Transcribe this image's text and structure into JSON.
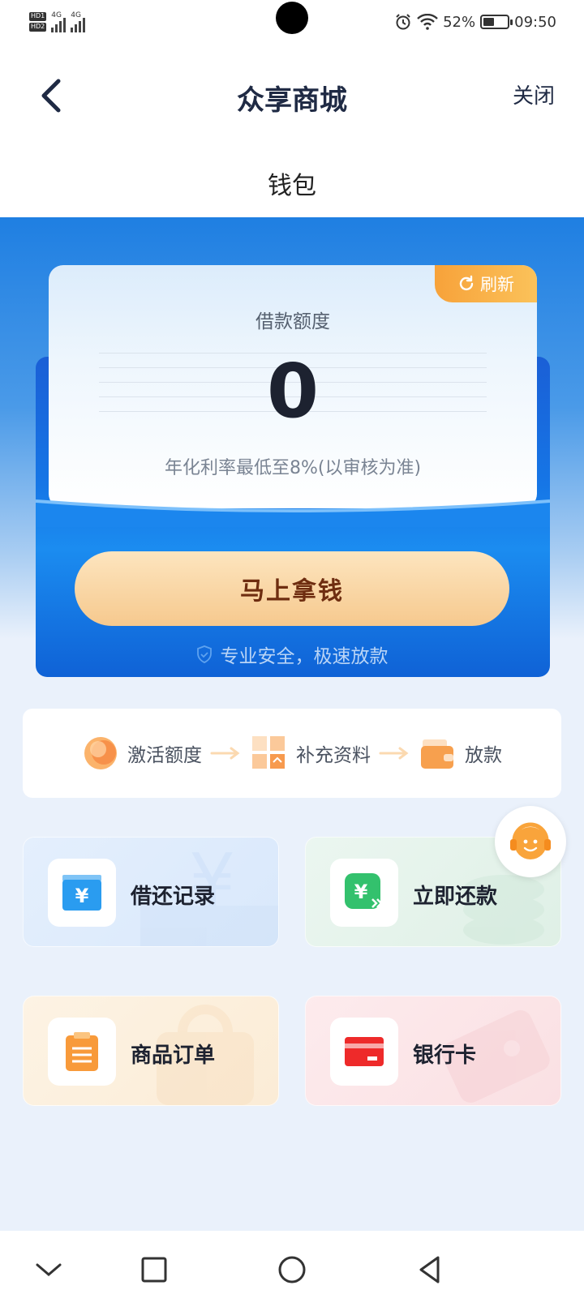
{
  "status_bar": {
    "sim1": "HD1",
    "sim2": "HD2",
    "net1": "4G",
    "net2": "4G",
    "battery_percent": "52%",
    "battery_level": 0.52,
    "time": "09:50",
    "icons": [
      "alarm-icon",
      "wifi-icon",
      "battery-icon"
    ]
  },
  "nav": {
    "title": "众享商城",
    "close_label": "关闭",
    "back_icon": "back-chevron-icon"
  },
  "subheader": {
    "title": "钱包"
  },
  "credit_card": {
    "refresh_label": "刷新",
    "label": "借款额度",
    "amount": "0",
    "rate_note": "年化利率最低至8%(以审核为准)"
  },
  "cta": {
    "label": "马上拿钱"
  },
  "safety_note": "专业安全，极速放款",
  "steps": [
    {
      "label": "激活额度",
      "icon": "coin-icon"
    },
    {
      "label": "补充资料",
      "icon": "documents-icon"
    },
    {
      "label": "放款",
      "icon": "wallet-icon"
    }
  ],
  "tiles": [
    {
      "label": "借还记录",
      "icon": "yuan-card-icon"
    },
    {
      "label": "立即还款",
      "icon": "yuan-forward-icon"
    },
    {
      "label": "商品订单",
      "icon": "clipboard-icon"
    },
    {
      "label": "银行卡",
      "icon": "bank-card-icon"
    }
  ],
  "colors": {
    "primary_blue": "#1676e6",
    "accent_orange": "#f7a23a",
    "cta_text": "#6e2d10",
    "tile_blue": "#e1eefc",
    "tile_green": "#e4f3ec",
    "tile_orange": "#fdf0de",
    "tile_red": "#fbe4e6"
  }
}
